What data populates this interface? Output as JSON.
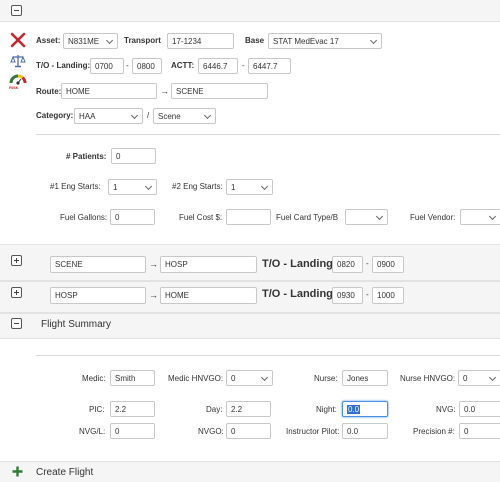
{
  "leg1": {
    "asset_label": "Asset:",
    "asset_value": "N831ME",
    "transport_label": "Transport",
    "transport_value": "17-1234",
    "base_label": "Base",
    "base_value": "STAT MedEvac 17",
    "to_landing_label": "T/O - Landing:",
    "to_value": "0700",
    "landing_value": "0800",
    "dash": "-",
    "actt_label": "ACTT:",
    "actt_start": "6446.7",
    "actt_end": "6447.7",
    "route_label": "Route:",
    "route_from": "HOME",
    "route_to": "SCENE",
    "arrow": "→",
    "category_label": "Category:",
    "category_value": "HAA",
    "category_sep": "/",
    "subcategory_value": "Scene",
    "patients_label": "# Patients:",
    "patients_value": "0",
    "eng1_label": "#1 Eng Starts:",
    "eng1_value": "1",
    "eng2_label": "#2 Eng Starts:",
    "eng2_value": "1",
    "fuel_gallons_label": "Fuel Gallons:",
    "fuel_gallons_value": "0",
    "fuel_cost_label": "Fuel Cost $:",
    "fuel_card_label": "Fuel Card Type/Bi",
    "fuel_vendor_label": "Fuel Vendor:",
    "risk_icon_text": "RISK"
  },
  "leg2": {
    "from": "SCENE",
    "to": "HOSP",
    "to_landing_label": "T/O - Landing:",
    "to_value": "0820",
    "landing_value": "0900"
  },
  "leg3": {
    "from": "HOSP",
    "to": "HOME",
    "to_landing_label": "T/O - Landing:",
    "to_value": "0930",
    "landing_value": "1000"
  },
  "summary": {
    "title": "Flight Summary",
    "medic_label": "Medic:",
    "medic_value": "Smith",
    "medic_hnvgo_label": "Medic HNVGO:",
    "medic_hnvgo_value": "0",
    "nurse_label": "Nurse:",
    "nurse_value": "Jones",
    "nurse_hnvgo_label": "Nurse HNVGO:",
    "nurse_hnvgo_value": "0",
    "pic_label": "PIC:",
    "pic_value": "2.2",
    "day_label": "Day:",
    "day_value": "2.2",
    "night_label": "Night:",
    "night_value": "0.0",
    "nvg_label": "NVG:",
    "nvg_value": "0.0",
    "nvgl_label": "NVG/L:",
    "nvgl_value": "0",
    "nvgo_label": "NVGO:",
    "nvgo_value": "0",
    "instructor_label": "Instructor Pilot:",
    "instructor_value": "0.0",
    "precision_label": "Precision #:",
    "precision_value": "0"
  },
  "create_flight_label": "Create Flight",
  "colors": {
    "delete": "#c62828",
    "create": "#2e7d32",
    "highlight": "#2d6fd6"
  }
}
